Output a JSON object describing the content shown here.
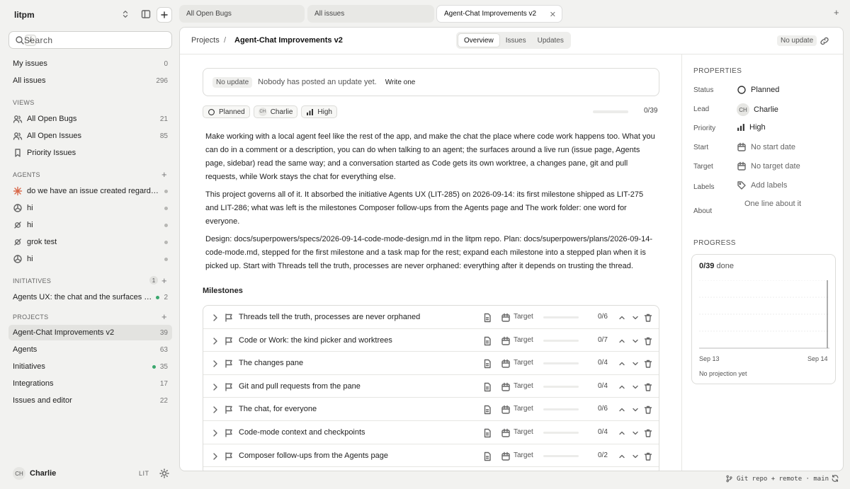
{
  "workspace": {
    "name": "litpm"
  },
  "search": {
    "placeholder": "Search",
    "shortcut": "/"
  },
  "sidebar": {
    "top": [
      {
        "label": "My issues",
        "count": "0"
      },
      {
        "label": "All issues",
        "count": "296"
      }
    ],
    "views_heading": "VIEWS",
    "views": [
      {
        "label": "All Open Bugs",
        "count": "21",
        "icon": "people-icon"
      },
      {
        "label": "All Open Issues",
        "count": "85",
        "icon": "people-icon"
      },
      {
        "label": "Priority Issues",
        "count": "",
        "icon": "bookmark-icon"
      }
    ],
    "agents_heading": "AGENTS",
    "agents": [
      {
        "label": "do we have an issue created regarding…",
        "icon": "sparkle-icon"
      },
      {
        "label": "hi",
        "icon": "openai-icon"
      },
      {
        "label": "hi",
        "icon": "grok-icon"
      },
      {
        "label": "grok test",
        "icon": "grok-icon"
      },
      {
        "label": "hi",
        "icon": "openai-icon"
      }
    ],
    "initiatives_heading": "INITIATIVES",
    "initiatives_badge": "1",
    "initiatives": [
      {
        "label": "Agents UX: the chat and the surfaces ar…",
        "count": "2"
      }
    ],
    "projects_heading": "PROJECTS",
    "projects": [
      {
        "label": "Agent-Chat Improvements v2",
        "count": "39"
      },
      {
        "label": "Agents",
        "count": "63"
      },
      {
        "label": "Initiatives",
        "count": "35"
      },
      {
        "label": "Integrations",
        "count": "17"
      },
      {
        "label": "Issues and editor",
        "count": "22"
      }
    ],
    "user": {
      "initials": "CH",
      "name": "Charlie",
      "org": "LIT"
    }
  },
  "tabs": [
    {
      "label": "All Open Bugs"
    },
    {
      "label": "All issues"
    },
    {
      "label": "Agent-Chat Improvements v2"
    }
  ],
  "topbar": {
    "crumb_root": "Projects",
    "crumb_sep": "/",
    "crumb_current": "Agent-Chat Improvements v2",
    "segments": [
      "Overview",
      "Issues",
      "Updates"
    ],
    "status": "No update"
  },
  "update_card": {
    "badge": "No update",
    "text": "Nobody has posted an update yet.",
    "action": "Write one"
  },
  "chips": {
    "status": "Planned",
    "lead_initials": "CH",
    "lead": "Charlie",
    "priority": "High"
  },
  "progress": {
    "text": "0/39",
    "fraction": 0
  },
  "description": [
    "Make working with a local agent feel like the rest of the app, and make the chat the place where code work happens too. What you can do in a comment or a description, you can do when talking to an agent; the surfaces around a live run (issue page, Agents page, sidebar) read the same way; and a conversation started as Code gets its own worktree, a changes pane, git and pull requests, while Work stays the chat for everything else.",
    "This project governs all of it. It absorbed the initiative Agents UX (LIT-285) on 2026-09-14: its first milestone shipped as LIT-275 and LIT-286; what was left is the milestones Composer follow-ups from the Agents page and The work folder: one word for everyone.",
    "Design: docs/superpowers/specs/2026-09-14-code-mode-design.md in the litpm repo. Plan: docs/superpowers/plans/2026-09-14-code-mode.md, stepped for the first milestone and a task map for the rest; expand each milestone into a stepped plan when it is picked up. Start with Threads tell the truth, processes are never orphaned: everything after it depends on trusting the thread."
  ],
  "milestones_heading": "Milestones",
  "milestones": [
    {
      "name": "Threads tell the truth, processes are never orphaned",
      "target": "Target",
      "count": "0/6",
      "progress": 0
    },
    {
      "name": "Code or Work: the kind picker and worktrees",
      "target": "Target",
      "count": "0/7",
      "progress": 0
    },
    {
      "name": "The changes pane",
      "target": "Target",
      "count": "0/4",
      "progress": 0
    },
    {
      "name": "Git and pull requests from the pane",
      "target": "Target",
      "count": "0/4",
      "progress": 0
    },
    {
      "name": "The chat, for everyone",
      "target": "Target",
      "count": "0/6",
      "progress": 0
    },
    {
      "name": "Code-mode context and checkpoints",
      "target": "Target",
      "count": "0/4",
      "progress": 0
    },
    {
      "name": "Composer follow-ups from the Agents page",
      "target": "Target",
      "count": "0/2",
      "progress": 0
    }
  ],
  "properties": {
    "heading": "PROPERTIES",
    "status_label": "Status",
    "status": "Planned",
    "lead_label": "Lead",
    "lead_initials": "CH",
    "lead": "Charlie",
    "priority_label": "Priority",
    "priority": "High",
    "start_label": "Start",
    "start": "No start date",
    "target_label": "Target",
    "target": "No target date",
    "labels_label": "Labels",
    "labels": "Add labels",
    "about_label": "About",
    "about": "One line about it"
  },
  "progress_panel": {
    "heading": "PROGRESS",
    "value": "0/39",
    "suffix": "done",
    "tick_start": "Sep 13",
    "tick_end": "Sep 14",
    "note": "No projection yet"
  },
  "footer": {
    "text": "Git repo + remote · main"
  }
}
